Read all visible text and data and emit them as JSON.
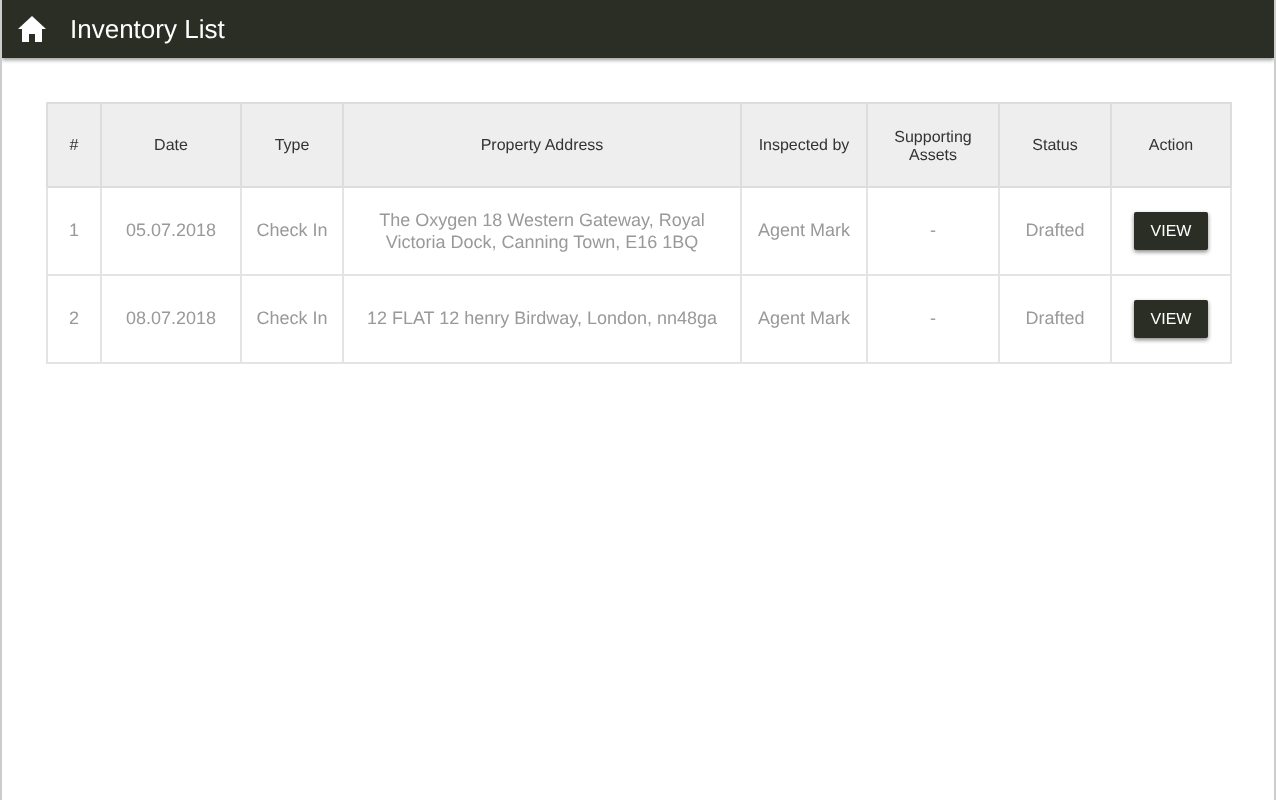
{
  "header": {
    "title": "Inventory List"
  },
  "table": {
    "columns": [
      "#",
      "Date",
      "Type",
      "Property Address",
      "Inspected by",
      "Supporting Assets",
      "Status",
      "Action"
    ],
    "rows": [
      {
        "number": "1",
        "date": "05.07.2018",
        "type": "Check In",
        "address": "The Oxygen 18 Western Gateway, Royal Victoria Dock, Canning Town, E16 1BQ",
        "inspected_by": "Agent Mark",
        "supporting_assets": "-",
        "status": "Drafted",
        "action": "VIEW"
      },
      {
        "number": "2",
        "date": "08.07.2018",
        "type": "Check In",
        "address": "12 FLAT 12 henry Birdway, London, nn48ga",
        "inspected_by": "Agent Mark",
        "supporting_assets": "-",
        "status": "Drafted",
        "action": "VIEW"
      }
    ]
  }
}
